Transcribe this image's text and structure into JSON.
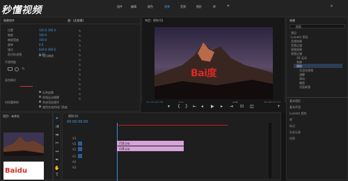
{
  "watermark": "秒懂视频",
  "menu": {
    "items": [
      "组件",
      "编辑",
      "颜色",
      "效果",
      "音频",
      "图形",
      "库"
    ],
    "active_index": 3
  },
  "source_panel": {
    "title": "源：(无剪辑)",
    "effect_controls_tab": "效果控件",
    "rows": [
      "位置",
      "缩放",
      "缩放宽度",
      "旋转",
      "锚点",
      "防闪烁滤镜",
      "不透明度",
      "混合模式",
      "时间重映射"
    ],
    "values": [
      "320.0  180.0",
      "100.0",
      "100.0",
      "0.0",
      "640.0  360.0",
      "0.00"
    ],
    "options": [
      "等比缩放",
      "反转遮罩",
      "视频运动模糊",
      "合成渲染顺序",
      "使用合成的快门角度"
    ]
  },
  "program_monitor": {
    "title": "节目：序列 01",
    "timecode": "00:00:00:00",
    "fit_label": "适合",
    "quality_label": "完整",
    "image_logo": "Bai度",
    "end_timecode": "00:00:12:11"
  },
  "effects_panel": {
    "title": "效果",
    "search_placeholder": "搜索",
    "tree": [
      "预设",
      "Lumetri 预设",
      "音频效果",
      "音频过渡",
      "视频效果",
      "视频过渡",
      "3D 运动",
      "划像",
      "擦除",
      "沉浸式视频",
      "溶解",
      "滑动",
      "缩放",
      "页面剥落"
    ],
    "footer": [
      "基本图形",
      "基本声音",
      "Lumetri 颜色",
      "库",
      "标记",
      "历史记录",
      "信息"
    ]
  },
  "project_panel": {
    "title": "项目：未命名",
    "thumb_label": "Baidu"
  },
  "timeline": {
    "title": "序列 01",
    "timecode": "00:00:00:00",
    "tracks": [
      "V3",
      "V2",
      "V1",
      "A1",
      "A2",
      "A3"
    ],
    "clip_v": "百度.jpg",
    "clip_v2": "风景.jpg"
  }
}
